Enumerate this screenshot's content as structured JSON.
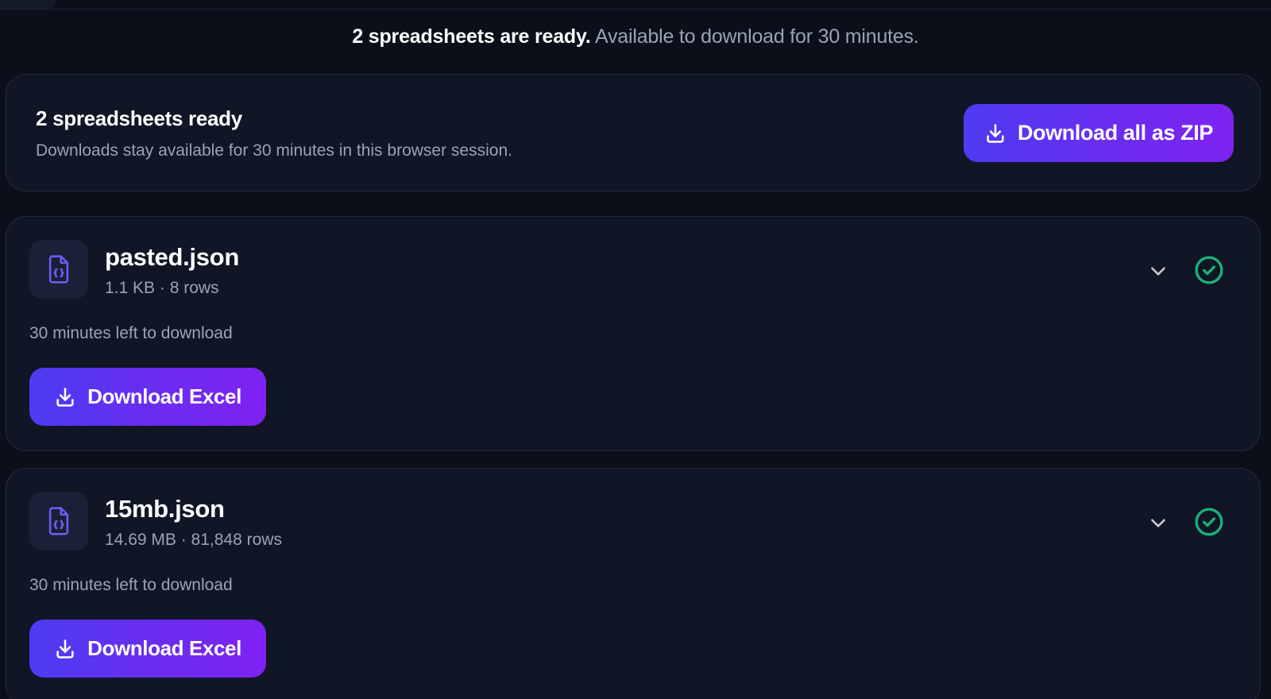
{
  "notice": {
    "strong": "2 spreadsheets are ready.",
    "muted": "Available to download for 30 minutes."
  },
  "summary": {
    "title": "2 spreadsheets ready",
    "subtitle": "Downloads stay available for 30 minutes in this browser session.",
    "zip_button": "Download all as ZIP"
  },
  "files": [
    {
      "name": "pasted.json",
      "meta": "1.1 KB · 8 rows",
      "time_left": "30 minutes left to download",
      "button": "Download Excel",
      "status": "ready"
    },
    {
      "name": "15mb.json",
      "meta": "14.69 MB · 81,848 rows",
      "time_left": "30 minutes left to download",
      "button": "Download Excel",
      "status": "ready"
    }
  ],
  "colors": {
    "background": "#0b0f1a",
    "card": "#111626",
    "accent_start": "#4d3cf2",
    "accent_end": "#7e22f2",
    "success": "#19b37a",
    "file_icon": "#6a5cf5"
  },
  "icons": {
    "download": "download-icon",
    "file": "json-file-icon",
    "expand": "chevron-down-icon",
    "status": "check-circle-icon"
  }
}
